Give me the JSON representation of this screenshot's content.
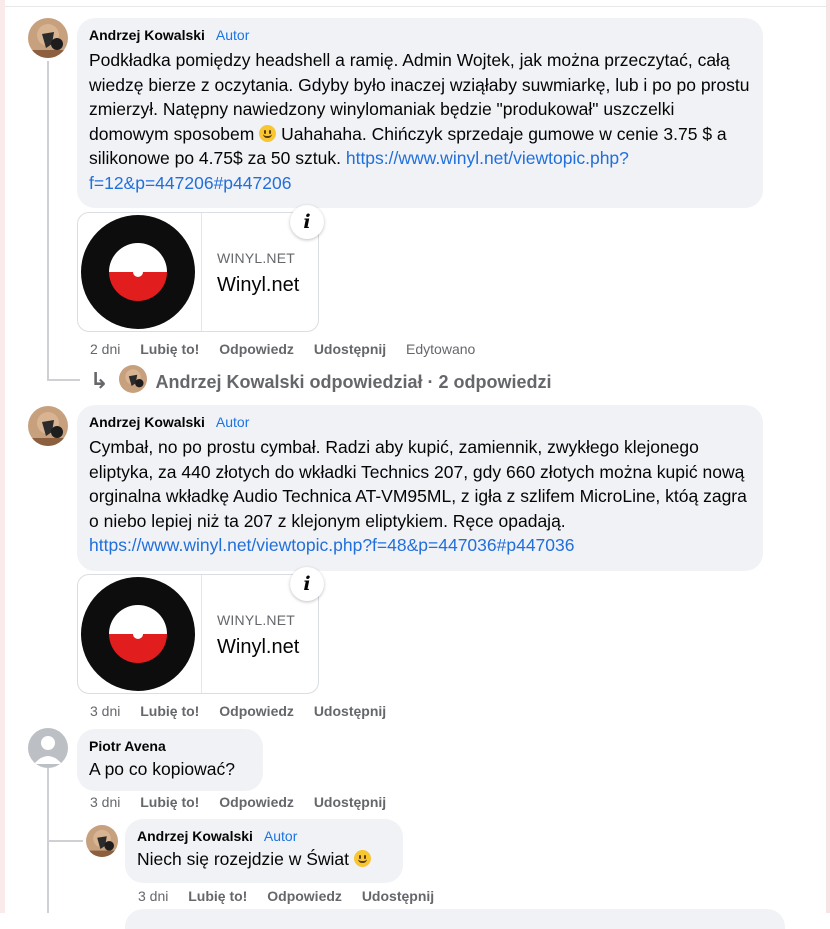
{
  "comments": [
    {
      "author": "Andrzej Kowalski",
      "badge": "Autor",
      "text": "Podkładka pomiędzy headshell a ramię. Admin Wojtek, jak można przeczytać, całą wiedzę bierze z oczytania. Gdyby było inaczej wziąłaby suwmiarkę, lub i po po prostu zmierzył. Natępny nawiedzony winylomaniak będzie \"produkował\" uszczelki domowym sposobem",
      "text_after_emoji": "Uahahaha. Chińczyk sprzedaje gumowe w cenie 3.75 $ a silikonowe po 4.75$ za 50 sztuk.",
      "link": "https://www.winyl.net/viewtopic.php?f=12&p=447206#p447206",
      "card": {
        "domain": "WINYL.NET",
        "title": "Winyl.net"
      },
      "time": "2 dni",
      "like": "Lubię to!",
      "reply": "Odpowiedz",
      "share": "Udostępnij",
      "edited": "Edytowano",
      "replies_summary": "Andrzej Kowalski odpowiedział · 2 odpowiedzi"
    },
    {
      "author": "Andrzej Kowalski",
      "badge": "Autor",
      "text": "Cymbał, no po prostu cymbał. Radzi aby kupić, zamiennik, zwykłego klejonego eliptyka, za 440 złotych do wkładki Technics 207, gdy 660 złotych można kupić nową orginalna wkładkę Audio Technica AT-VM95ML, z igła z szlifem MicroLine, któą zagra o niebo lepiej niż ta 207 z klejonym eliptykiem. Ręce opadają.",
      "link": "https://www.winyl.net/viewtopic.php?f=48&p=447036#p447036",
      "card": {
        "domain": "WINYL.NET",
        "title": "Winyl.net"
      },
      "time": "3 dni",
      "like": "Lubię to!",
      "reply": "Odpowiedz",
      "share": "Udostępnij"
    },
    {
      "author": "Piotr Avena",
      "text": "A po co kopiować?",
      "time": "3 dni",
      "like": "Lubię to!",
      "reply": "Odpowiedz",
      "share": "Udostępnij"
    },
    {
      "author": "Andrzej Kowalski",
      "badge": "Autor",
      "text": "Niech się rozejdzie w Świat",
      "time": "3 dni",
      "like": "Lubię to!",
      "reply": "Odpowiedz",
      "share": "Udostępnij"
    }
  ],
  "icons": {
    "info": "i",
    "reply_arrow": "↳"
  },
  "colors": {
    "badge": "#1b74e4",
    "link": "#216fdb",
    "bubble": "#f0f2f5",
    "meta": "#65676b"
  }
}
